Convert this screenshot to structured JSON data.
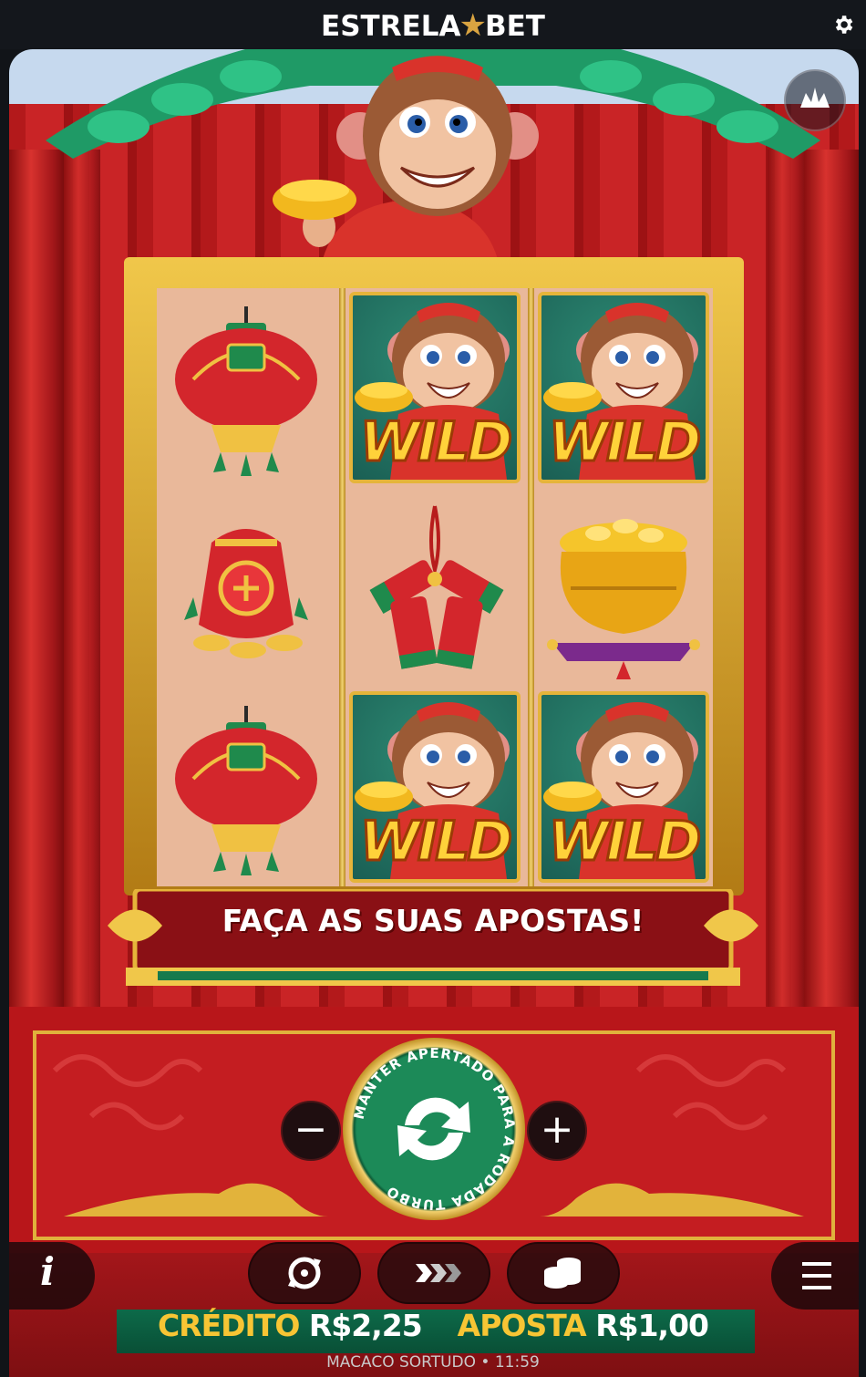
{
  "header": {
    "brand_left": "ESTRELA",
    "brand_right": "BET"
  },
  "icons": {
    "settings": "gear-icon",
    "home": "crown-icon",
    "info": "info-icon",
    "autoplay": "autoplay-icon",
    "turbo": "turbo-icon",
    "bet": "coin-stack-icon",
    "menu": "hamburger-icon"
  },
  "reels": [
    [
      "lantern",
      "lucky-bag",
      "lantern"
    ],
    [
      "wild",
      "firecrackers",
      "wild"
    ],
    [
      "wild",
      "gold-pot",
      "wild"
    ]
  ],
  "wild_label": "WILD",
  "banner": {
    "message": "FAÇA AS SUAS APOSTAS!"
  },
  "controls": {
    "minus_label": "−",
    "plus_label": "+",
    "spin_ring_text": "MANTER APERTADO PARA A RODADA TURBO",
    "info_label": "i"
  },
  "status": {
    "credit_label": "CRÉDITO",
    "credit_value": "R$2,25",
    "bet_label": "APOSTA",
    "bet_value": "R$1,00"
  },
  "footer": {
    "text": "MACACO SORTUDO • 11:59"
  },
  "colors": {
    "accent_gold": "#f7c534",
    "panel_red": "#b8161a",
    "spin_green": "#1c8a58"
  }
}
